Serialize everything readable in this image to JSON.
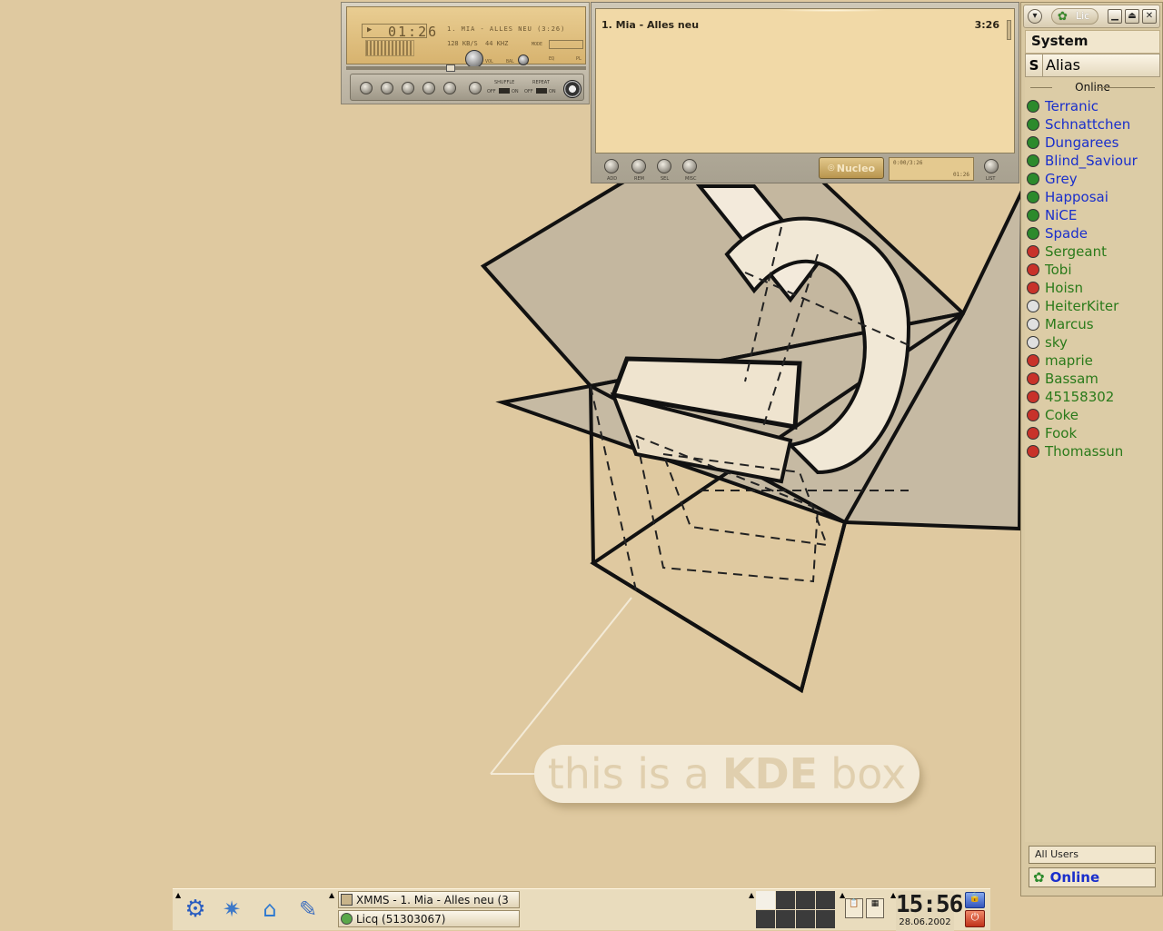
{
  "wallpaper": {
    "slogan_prefix": "this is a",
    "slogan_brand": "KDE",
    "slogan_suffix": "box"
  },
  "xmms": {
    "time": "01:26",
    "title_scroll": "1. MIA - ALLES NEU (3:26)",
    "bitrate": "128 KB/S",
    "samplerate": "44 KHZ",
    "labels": {
      "vol": "VOL",
      "bal": "BAL",
      "mode": "MODE",
      "eq": "EQ",
      "pl": "PL",
      "shuffle": "SHUFFLE",
      "repeat": "REPEAT",
      "off": "OFF",
      "on": "ON"
    }
  },
  "playlist": {
    "song": "1. Mia - Alles neu",
    "length": "3:26",
    "buttons": [
      "ADD",
      "REM",
      "SEL",
      "MISC"
    ],
    "list_button": "LIST",
    "brand": "Nucleo",
    "lcd_top": "0:00/3:26",
    "lcd_time": "01:26"
  },
  "licq": {
    "title": "Lic",
    "menu_label": "System",
    "header_status": "S",
    "header_alias": "Alias",
    "group_label": "Online",
    "contacts": [
      {
        "name": "Terranic",
        "status": "online"
      },
      {
        "name": "Schnattchen",
        "status": "online"
      },
      {
        "name": "Dungarees",
        "status": "online"
      },
      {
        "name": "Blind_Saviour",
        "status": "online"
      },
      {
        "name": "Grey",
        "status": "online"
      },
      {
        "name": "Happosai",
        "status": "online"
      },
      {
        "name": "NiCE",
        "status": "online"
      },
      {
        "name": "Spade",
        "status": "online"
      },
      {
        "name": "Sergeant",
        "status": "away"
      },
      {
        "name": "Tobi",
        "status": "away"
      },
      {
        "name": "Hoisn",
        "status": "away"
      },
      {
        "name": "HeiterKiter",
        "status": "dnd"
      },
      {
        "name": "Marcus",
        "status": "dnd"
      },
      {
        "name": "sky",
        "status": "dnd"
      },
      {
        "name": "maprie",
        "status": "na"
      },
      {
        "name": "Bassam",
        "status": "na"
      },
      {
        "name": "45158302",
        "status": "na"
      },
      {
        "name": "Coke",
        "status": "na"
      },
      {
        "name": "Fook",
        "status": "na"
      },
      {
        "name": "Thomassun",
        "status": "na"
      }
    ],
    "group_select": "All Users",
    "status_select": "Online",
    "colors": {
      "online_text": "#1a2fcc",
      "away_text": "#2a7a1a",
      "online_icon": "#2c8a2c",
      "away_icon": "#c8322a",
      "dnd_icon": "#e0e0e0",
      "na_icon": "#c8322a"
    }
  },
  "taskbar": {
    "tasks": [
      {
        "label": "XMMS - 1. Mia - Alles neu (3"
      },
      {
        "label": "Licq (51303067)"
      }
    ],
    "clock_time": "15:56",
    "clock_date": "28.06.2002"
  }
}
